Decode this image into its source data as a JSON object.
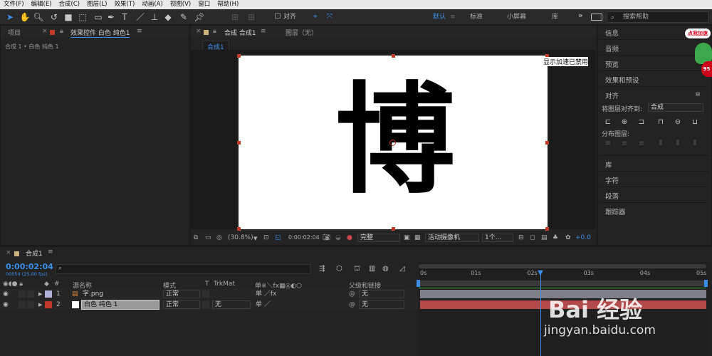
{
  "menu": [
    "文件(F)",
    "编辑(E)",
    "合成(C)",
    "图层(L)",
    "效果(T)",
    "动画(A)",
    "视图(V)",
    "窗口",
    "帮助(H)"
  ],
  "toolbar": {
    "snap_label": "对齐",
    "workspaces": [
      "默认",
      "标准",
      "小屏幕",
      "库"
    ],
    "active_workspace": "默认",
    "more_label": "»",
    "search_placeholder": "搜索帮助"
  },
  "left_panel": {
    "tab_project": "项目",
    "tab_effects": "效果控件 白色 纯色1",
    "subline": "合成 1 • 白色 纯色 1"
  },
  "comp_panel": {
    "tab_comp": "合成 合成1",
    "tab_layer": "图层（无）",
    "sub_tab": "合成1",
    "gpu_notice": "显示加速已禁用",
    "canvas_char": "博",
    "zoom": "(30.8%)",
    "timecode": "0:00:02:04",
    "resolution": "完整",
    "camera": "活动摄像机",
    "views": "1个...",
    "exposure": "+0.0"
  },
  "right_panel": {
    "items_top": [
      "信息",
      "音频",
      "预览",
      "效果和预设"
    ],
    "align_title": "对齐",
    "align_to_label": "将图层对齐到:",
    "align_to_value": "合成",
    "distribute_label": "分布图层:",
    "items_bottom": [
      "库",
      "字符",
      "段落",
      "跟踪器"
    ]
  },
  "timeline": {
    "tab": "合成1",
    "current_time": "0:00:02:04",
    "fps": "00054 (25.00 fps)",
    "search_placeholder": "",
    "col_source": "源名称",
    "col_mode": "模式",
    "col_t": "T",
    "col_trkmat": "TrkMat",
    "col_parent": "父级和链接",
    "ruler": [
      "0s",
      "01s",
      "02s",
      "03s",
      "04s",
      "05s"
    ],
    "playhead_fraction": 0.4272,
    "layers": [
      {
        "num": "1",
        "name": "字.png",
        "mode": "正常",
        "trkmat": "",
        "parent": "无",
        "label_color": "#b3b3d8",
        "bar_color": "#7f7f8a"
      },
      {
        "num": "2",
        "name": "白色 纯色 1",
        "mode": "正常",
        "trkmat": "无",
        "parent": "无",
        "label_color": "#c0392b",
        "bar_color": "#b24a4a"
      }
    ]
  },
  "watermark": {
    "brand": "Bai 经验",
    "url": "jingyan.baidu.com"
  },
  "ad_badge": {
    "label": "点我加速",
    "number": "95"
  },
  "colors": {
    "accent": "#3b8ee8",
    "panel": "#232323",
    "menubar": "#e9e9e9",
    "work_area": "#3a3a3a"
  }
}
